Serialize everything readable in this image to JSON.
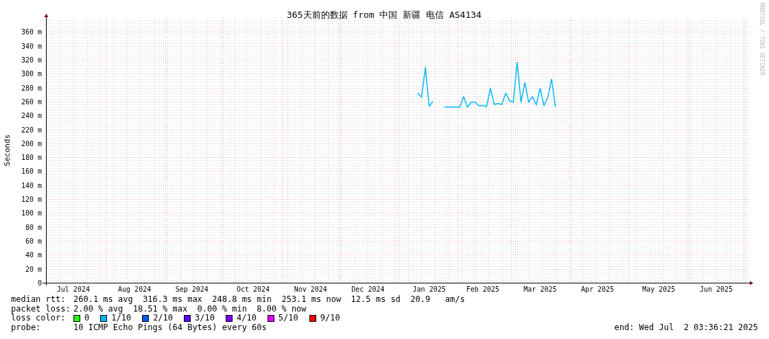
{
  "chart": {
    "title": "365天前的数据 from 中国 新疆 电信 AS4134",
    "credit": "RRDTOOL / TOBI OETIKER",
    "chart_data": {
      "type": "line",
      "grid": true,
      "ylabel": "Seconds",
      "ylim": [
        0,
        380
      ],
      "categories": [
        null,
        null,
        null,
        null,
        null,
        null,
        null,
        "Jul 2024",
        null,
        null,
        null,
        null,
        null,
        null,
        null,
        null,
        null,
        null,
        null,
        null,
        null,
        null,
        null,
        "Aug 2024",
        null,
        null,
        null,
        null,
        null,
        null,
        null,
        null,
        null,
        null,
        null,
        null,
        null,
        null,
        "Sep 2024",
        null,
        null,
        null,
        null,
        null,
        null,
        null,
        null,
        null,
        null,
        null,
        null,
        null,
        null,
        null,
        "Oct 2024",
        null,
        null,
        null,
        null,
        null,
        null,
        null,
        null,
        null,
        null,
        null,
        null,
        null,
        null,
        "Nov 2024",
        null,
        null,
        null,
        null,
        null,
        null,
        null,
        null,
        null,
        null,
        null,
        null,
        null,
        null,
        "Dec 2024",
        null,
        null,
        null,
        null,
        null,
        null,
        null,
        null,
        null,
        null,
        null,
        null,
        null,
        null,
        null,
        "Jan 2025",
        null,
        null,
        null,
        null,
        null,
        null,
        null,
        null,
        null,
        null,
        null,
        null,
        null,
        "Feb 2025",
        null,
        null,
        null,
        null,
        null,
        null,
        null,
        null,
        null,
        null,
        null,
        null,
        null,
        null,
        "Mar 2025",
        null,
        null,
        null,
        null,
        null,
        null,
        null,
        null,
        null,
        null,
        null,
        null,
        null,
        null,
        "Apr 2025",
        null,
        null,
        null,
        null,
        null,
        null,
        null,
        null,
        null,
        null,
        null,
        null,
        null,
        null,
        null,
        "May 2025",
        null,
        null,
        null,
        null,
        null,
        null,
        null,
        null,
        null,
        null,
        null,
        null,
        null,
        null,
        "Jun 2025",
        null,
        null,
        null,
        null,
        null,
        null,
        null,
        null
      ],
      "series": [
        {
          "color": "#00b8ff",
          "values": [
            null,
            null,
            null,
            null,
            null,
            null,
            null,
            null,
            null,
            null,
            null,
            null,
            null,
            null,
            null,
            null,
            null,
            null,
            null,
            null,
            null,
            null,
            null,
            null,
            null,
            null,
            null,
            null,
            null,
            null,
            null,
            null,
            null,
            null,
            null,
            null,
            null,
            null,
            null,
            null,
            null,
            null,
            null,
            null,
            null,
            null,
            null,
            null,
            null,
            null,
            null,
            null,
            null,
            null,
            null,
            null,
            null,
            null,
            null,
            null,
            null,
            null,
            null,
            null,
            null,
            null,
            null,
            null,
            null,
            null,
            null,
            null,
            null,
            null,
            null,
            null,
            null,
            null,
            null,
            null,
            null,
            null,
            null,
            null,
            null,
            null,
            null,
            null,
            null,
            null,
            null,
            null,
            null,
            null,
            null,
            null,
            null,
            272,
            266,
            309,
            253,
            260,
            null,
            null,
            252,
            252,
            252,
            252,
            252,
            267,
            252,
            259,
            259,
            254,
            254,
            253,
            279,
            256,
            257,
            256,
            272,
            261,
            259,
            316,
            259,
            287,
            259,
            267,
            255,
            279,
            254,
            266,
            292,
            252,
            null,
            null,
            null,
            null,
            null,
            null,
            null,
            null,
            null,
            null,
            null,
            null,
            null,
            null,
            null,
            null,
            null,
            null,
            null,
            null,
            null,
            null,
            null,
            null,
            null,
            null,
            null,
            null,
            null,
            null,
            null,
            null,
            null,
            null,
            null,
            null,
            null,
            null,
            null,
            null,
            null,
            null,
            null,
            null,
            null,
            null,
            null,
            null,
            null,
            null
          ]
        }
      ],
      "yticks": [
        {
          "value": 0,
          "label": "0"
        },
        {
          "value": 20,
          "label": "20 m"
        },
        {
          "value": 40,
          "label": "40 m"
        },
        {
          "value": 60,
          "label": "60 m"
        },
        {
          "value": 80,
          "label": "80 m"
        },
        {
          "value": 100,
          "label": "100 m"
        },
        {
          "value": 120,
          "label": "120 m"
        },
        {
          "value": 140,
          "label": "140 m"
        },
        {
          "value": 160,
          "label": "160 m"
        },
        {
          "value": 180,
          "label": "180 m"
        },
        {
          "value": 200,
          "label": "200 m"
        },
        {
          "value": 220,
          "label": "220 m"
        },
        {
          "value": 240,
          "label": "240 m"
        },
        {
          "value": 260,
          "label": "260 m"
        },
        {
          "value": 280,
          "label": "280 m"
        },
        {
          "value": 300,
          "label": "300 m"
        },
        {
          "value": 320,
          "label": "320 m"
        },
        {
          "value": 340,
          "label": "340 m"
        },
        {
          "value": 360,
          "label": "360 m"
        }
      ]
    }
  },
  "legend": {
    "rows": [
      {
        "kind": "text",
        "label": "median rtt:",
        "value": "260.1 ms avg  316.3 ms max  248.8 ms min  253.1 ms now  12.5 ms sd  20.9   am/s"
      },
      {
        "kind": "text",
        "label": "packet loss:",
        "value": "2.00 % avg  18.51 % max  0.00 % min  8.00 % now"
      },
      {
        "kind": "colors",
        "label": "loss color:",
        "items": [
          {
            "label": "0",
            "color": "#26ff00"
          },
          {
            "label": "1/10",
            "color": "#00b8ff"
          },
          {
            "label": "2/10",
            "color": "#0059ff"
          },
          {
            "label": "3/10",
            "color": "#5e00ff"
          },
          {
            "label": "4/10",
            "color": "#7e00ff"
          },
          {
            "label": "5/10",
            "color": "#dd00ff"
          },
          {
            "label": "9/10",
            "color": "#ff0000"
          }
        ]
      },
      {
        "kind": "probe",
        "label": "probe:",
        "value": "10 ICMP Echo Pings (64 Bytes) every 60s",
        "end": "end: Wed Jul  2 03:36:21 2025"
      }
    ]
  }
}
